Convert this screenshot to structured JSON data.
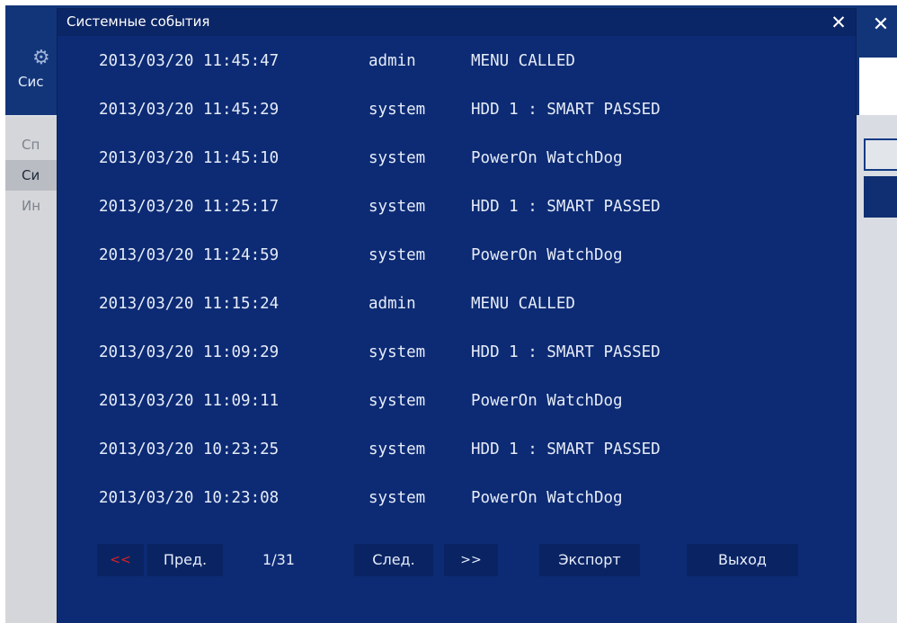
{
  "background_window": {
    "title": "Сис",
    "side_items": [
      {
        "label": "Сп",
        "active": false
      },
      {
        "label": "Си",
        "active": true
      },
      {
        "label": "Ин",
        "active": false
      }
    ],
    "close_label": "✕"
  },
  "dialog": {
    "title": "Системные события",
    "close_label": "✕",
    "rows": [
      {
        "time": "2013/03/20 11:45:47",
        "user": "admin",
        "event": "MENU CALLED"
      },
      {
        "time": "2013/03/20 11:45:29",
        "user": "system",
        "event": "HDD 1 : SMART PASSED"
      },
      {
        "time": "2013/03/20 11:45:10",
        "user": "system",
        "event": "PowerOn WatchDog"
      },
      {
        "time": "2013/03/20 11:25:17",
        "user": "system",
        "event": "HDD 1 : SMART PASSED"
      },
      {
        "time": "2013/03/20 11:24:59",
        "user": "system",
        "event": "PowerOn WatchDog"
      },
      {
        "time": "2013/03/20 11:15:24",
        "user": "admin",
        "event": "MENU CALLED"
      },
      {
        "time": "2013/03/20 11:09:29",
        "user": "system",
        "event": "HDD 1 : SMART PASSED"
      },
      {
        "time": "2013/03/20 11:09:11",
        "user": "system",
        "event": "PowerOn WatchDog"
      },
      {
        "time": "2013/03/20 10:23:25",
        "user": "system",
        "event": "HDD 1 : SMART PASSED"
      },
      {
        "time": "2013/03/20 10:23:08",
        "user": "system",
        "event": "PowerOn WatchDog"
      }
    ],
    "footer": {
      "first": "<<",
      "prev": "Пред.",
      "page": "1/31",
      "next": "След.",
      "last": ">>",
      "export": "Экспорт",
      "exit": "Выход"
    }
  },
  "colors": {
    "dialog_bg": "#0d2b74",
    "title_bar": "#0b2666",
    "button_bg": "#0a2463",
    "text": "#e6ecf8",
    "first_button": "#e02222"
  }
}
